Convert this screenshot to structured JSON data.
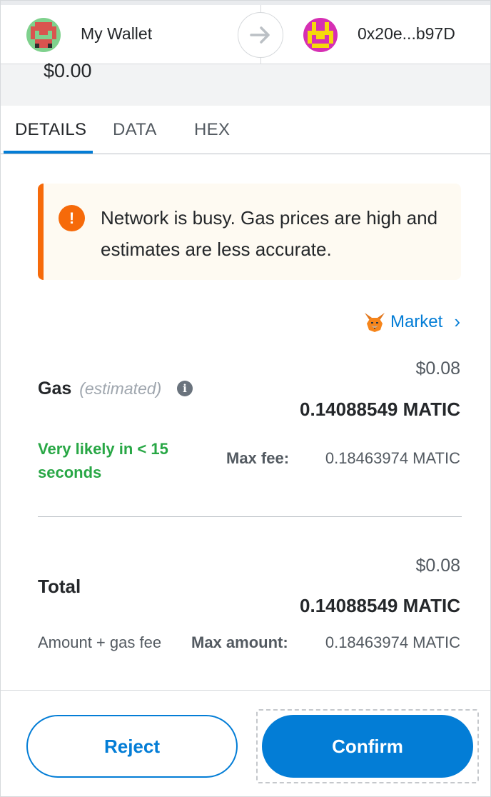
{
  "header": {
    "from_account": {
      "name": "My Wallet",
      "avatar": "identicon-green-red"
    },
    "arrow_icon": "arrow-right-icon",
    "to_account": {
      "name": "0x20e...b97D",
      "avatar": "identicon-magenta-yellow"
    }
  },
  "amount": {
    "fiat": "$0.00"
  },
  "tabs": [
    {
      "label": "DETAILS",
      "active": true
    },
    {
      "label": "DATA",
      "active": false
    },
    {
      "label": "HEX",
      "active": false
    }
  ],
  "warning": {
    "icon": "exclamation-icon",
    "text": "Network is busy. Gas prices are high and estimates are less accurate."
  },
  "market": {
    "icon": "fox-icon",
    "label": "Market",
    "chevron": "›"
  },
  "gas": {
    "label": "Gas",
    "sublabel": "(estimated)",
    "info_icon": "info-icon",
    "fiat": "$0.08",
    "native": "0.14088549 MATIC",
    "timing": "Very likely in < 15 seconds",
    "max_fee_label": "Max fee:",
    "max_fee_value": "0.18463974 MATIC"
  },
  "total": {
    "label": "Total",
    "fiat": "$0.08",
    "native": "0.14088549 MATIC",
    "sublabel": "Amount + gas fee",
    "max_amount_label": "Max amount:",
    "max_amount_value": "0.18463974 MATIC"
  },
  "footer": {
    "reject_label": "Reject",
    "confirm_label": "Confirm"
  },
  "colors": {
    "primary": "#037dd6",
    "warning": "#f66a0a",
    "success": "#28a745",
    "text": "#24272a"
  }
}
